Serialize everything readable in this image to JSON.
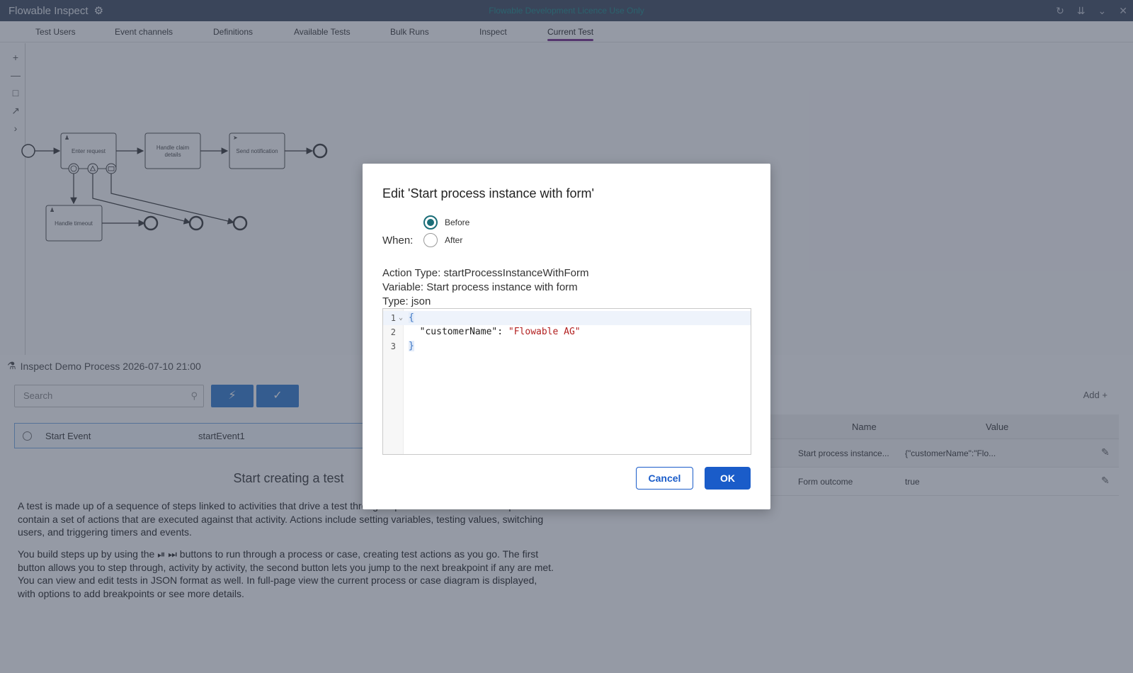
{
  "app": {
    "title": "Flowable Inspect",
    "licence_text": "Flowable Development Licence Use Only"
  },
  "tabs": [
    {
      "label": "Test Users"
    },
    {
      "label": "Event channels"
    },
    {
      "label": "Definitions"
    },
    {
      "label": "Available Tests"
    },
    {
      "label": "Bulk Runs"
    },
    {
      "label": "Inspect"
    },
    {
      "label": "Current Test",
      "active": true
    }
  ],
  "diagram": {
    "tasks": {
      "enter_request": "Enter request",
      "handle_claim_line1": "Handle claim",
      "handle_claim_line2": "details",
      "send_notification": "Send notification",
      "handle_timeout": "Handle timeout"
    }
  },
  "test": {
    "process_title": "Inspect Demo Process 2026-07-10 21:00",
    "search_placeholder": "Search",
    "event_row": {
      "name": "Start Event",
      "id": "startEvent1"
    },
    "start_title": "Start creating a test",
    "intro_paragraph": "A test is made up of a sequence of steps linked to activities that drive a test through a process or case. Each step can contain a set of actions that are executed against that activity. Actions include setting variables, testing values, switching users, and triggering timers and events.",
    "steps_paragraph_before": "You build steps up by using the",
    "steps_paragraph_after": "buttons to run through a process or case, creating test actions as you go. The first button allows you to step through, activity by activity, the second button lets you jump to the next breakpoint if any are met. You can view and edit tests in JSON format as well. In full-page view the current process or case diagram is displayed, with options to add breakpoints or see more details."
  },
  "actions_panel": {
    "add_label": "Add",
    "columns": {
      "name": "Name",
      "value": "Value"
    },
    "rows": [
      {
        "name": "Start process instance...",
        "value": "{\"customerName\":\"Flo..."
      },
      {
        "name": "Form outcome",
        "value": "true"
      }
    ]
  },
  "modal": {
    "title": "Edit 'Start process instance with form'",
    "when_label": "When:",
    "options": [
      {
        "label": "Before",
        "checked": true
      },
      {
        "label": "After",
        "checked": false
      }
    ],
    "action_type": "Action Type: startProcessInstanceWithForm",
    "variable": "Variable: Start process instance with form",
    "type": "Type: json",
    "editor": {
      "line_numbers": [
        "1",
        "2",
        "3"
      ],
      "open_brace": "{",
      "key": "\"customerName\": ",
      "value": "\"Flowable AG\"",
      "close_brace": "}"
    },
    "cancel_label": "Cancel",
    "ok_label": "OK"
  },
  "colors": {
    "accent": "#1a5cc9",
    "radio": "#1b6e78",
    "tab_indicator": "#8a4a9b",
    "titlebar": "#5a6577"
  }
}
